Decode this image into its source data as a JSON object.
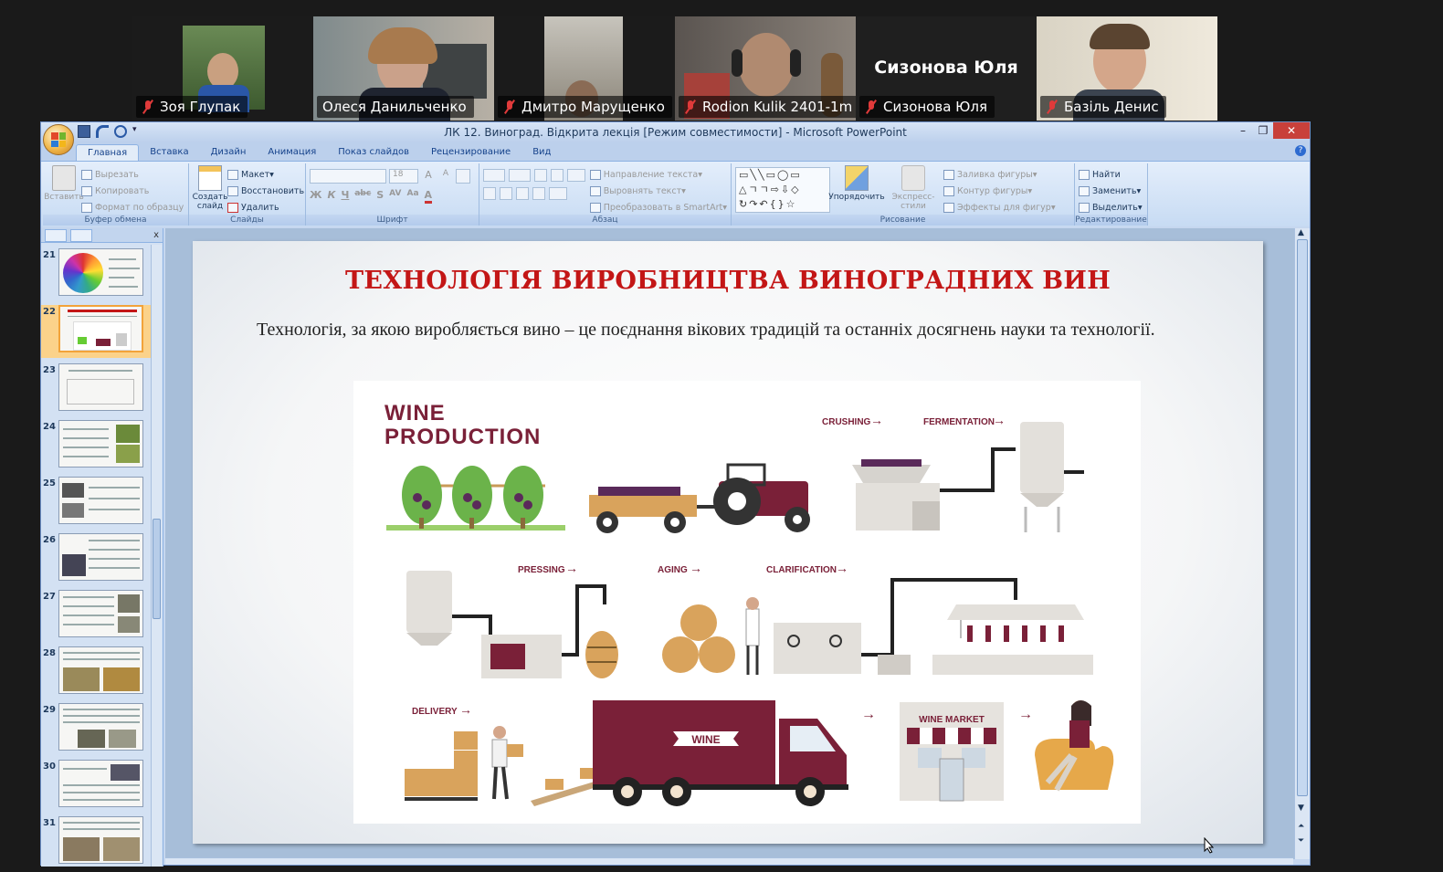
{
  "participants": [
    {
      "name": "Зоя Глупак",
      "muted": true,
      "active": false,
      "video": "photo"
    },
    {
      "name": "Олеся Данильченко",
      "muted": false,
      "active": true,
      "video": "photo"
    },
    {
      "name": "Дмитро Марущенко",
      "muted": true,
      "active": false,
      "video": "photo"
    },
    {
      "name": "Rodion Kulik 2401-1m",
      "muted": true,
      "active": false,
      "video": "photo"
    },
    {
      "name": "Сизонова Юля",
      "muted": true,
      "active": false,
      "video": "name-only",
      "display_name": "Сизонова Юля"
    },
    {
      "name": "Базіль Денис",
      "muted": true,
      "active": false,
      "video": "photo"
    }
  ],
  "window": {
    "title": "ЛК 12. Виноград. Відкрита лекція [Режим совместимости] - Microsoft PowerPoint",
    "minimize_icon": "minimize-icon",
    "restore_icon": "restore-icon",
    "close_icon": "close-icon"
  },
  "tabs": [
    "Главная",
    "Вставка",
    "Дизайн",
    "Анимация",
    "Показ слайдов",
    "Рецензирование",
    "Вид"
  ],
  "selected_tab": "Главная",
  "ribbon": {
    "clipboard": {
      "name": "Буфер обмена",
      "paste": "Вставить",
      "cut": "Вырезать",
      "copy": "Копировать",
      "format_painter": "Формат по образцу"
    },
    "slides": {
      "name": "Слайды",
      "new_slide": "Создать слайд",
      "layout": "Макет",
      "reset": "Восстановить",
      "delete": "Удалить"
    },
    "font": {
      "name": "Шрифт",
      "font_name": "",
      "font_size": "18",
      "bold": "Ж",
      "italic": "К",
      "underline": "Ч",
      "strike": "abc",
      "shadow": "S",
      "spacing": "AV",
      "case": "Aa",
      "color": "A",
      "grow": "A",
      "shrink": "A"
    },
    "paragraph": {
      "name": "Абзац",
      "direction": "Направление текста",
      "align": "Выровнять текст",
      "smartart": "Преобразовать в SmartArt"
    },
    "drawing": {
      "name": "Рисование",
      "arrange": "Упорядочить",
      "quick_styles": "Экспресс-стили",
      "fill": "Заливка фигуры",
      "outline": "Контур фигуры",
      "effects": "Эффекты для фигур"
    },
    "editing": {
      "name": "Редактирование",
      "find": "Найти",
      "replace": "Заменить",
      "select": "Выделить"
    }
  },
  "slide_numbers": [
    "21",
    "22",
    "23",
    "24",
    "25",
    "26",
    "27",
    "28",
    "29",
    "30",
    "31"
  ],
  "selected_slide": "22",
  "slide": {
    "title": "ТЕХНОЛОГІЯ ВИРОБНИЦТВА ВИНОГРАДНИХ ВИН",
    "body": "Технологія, за якою виробляється вино – це поєднання вікових традицій та останніх досягнень науки та технології.",
    "infographic": {
      "heading_line1": "WINE",
      "heading_line2": "PRODUCTION",
      "stages": [
        "CRUSHING",
        "FERMENTATION",
        "PRESSING",
        "AGING",
        "CLARIFICATION",
        "DELIVERY"
      ],
      "truck_label": "WINE",
      "shop_label": "WINE MARKET"
    }
  },
  "colors": {
    "title_red": "#c31616",
    "wine": "#7a2038",
    "active_speaker": "#2ee07a"
  }
}
